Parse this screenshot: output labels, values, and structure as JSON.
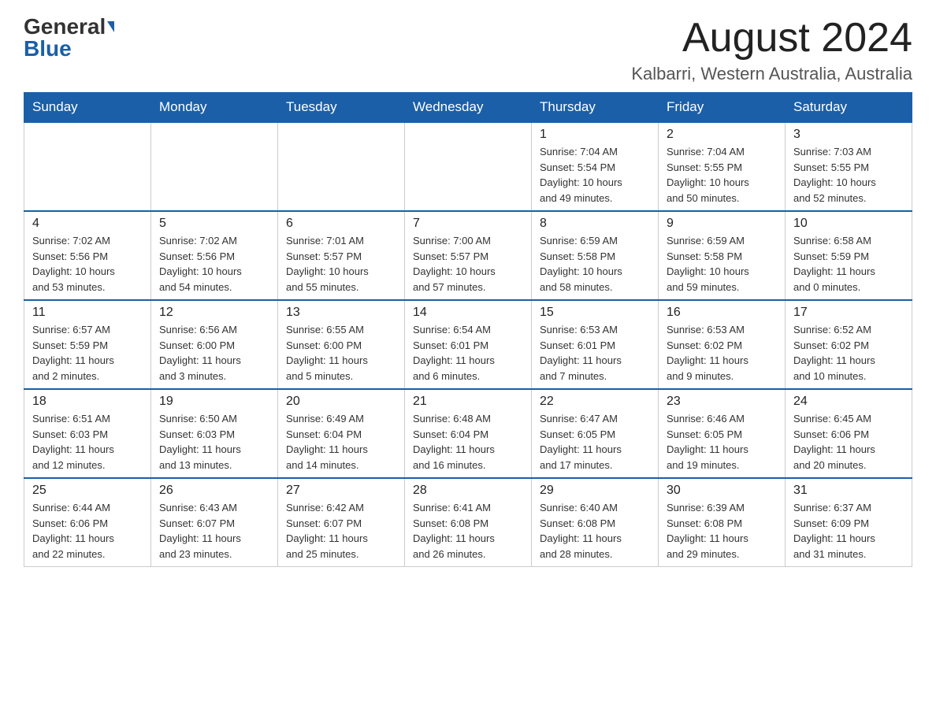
{
  "logo": {
    "general": "General",
    "blue": "Blue"
  },
  "title": "August 2024",
  "location": "Kalbarri, Western Australia, Australia",
  "weekdays": [
    "Sunday",
    "Monday",
    "Tuesday",
    "Wednesday",
    "Thursday",
    "Friday",
    "Saturday"
  ],
  "weeks": [
    [
      {
        "day": "",
        "info": ""
      },
      {
        "day": "",
        "info": ""
      },
      {
        "day": "",
        "info": ""
      },
      {
        "day": "",
        "info": ""
      },
      {
        "day": "1",
        "info": "Sunrise: 7:04 AM\nSunset: 5:54 PM\nDaylight: 10 hours\nand 49 minutes."
      },
      {
        "day": "2",
        "info": "Sunrise: 7:04 AM\nSunset: 5:55 PM\nDaylight: 10 hours\nand 50 minutes."
      },
      {
        "day": "3",
        "info": "Sunrise: 7:03 AM\nSunset: 5:55 PM\nDaylight: 10 hours\nand 52 minutes."
      }
    ],
    [
      {
        "day": "4",
        "info": "Sunrise: 7:02 AM\nSunset: 5:56 PM\nDaylight: 10 hours\nand 53 minutes."
      },
      {
        "day": "5",
        "info": "Sunrise: 7:02 AM\nSunset: 5:56 PM\nDaylight: 10 hours\nand 54 minutes."
      },
      {
        "day": "6",
        "info": "Sunrise: 7:01 AM\nSunset: 5:57 PM\nDaylight: 10 hours\nand 55 minutes."
      },
      {
        "day": "7",
        "info": "Sunrise: 7:00 AM\nSunset: 5:57 PM\nDaylight: 10 hours\nand 57 minutes."
      },
      {
        "day": "8",
        "info": "Sunrise: 6:59 AM\nSunset: 5:58 PM\nDaylight: 10 hours\nand 58 minutes."
      },
      {
        "day": "9",
        "info": "Sunrise: 6:59 AM\nSunset: 5:58 PM\nDaylight: 10 hours\nand 59 minutes."
      },
      {
        "day": "10",
        "info": "Sunrise: 6:58 AM\nSunset: 5:59 PM\nDaylight: 11 hours\nand 0 minutes."
      }
    ],
    [
      {
        "day": "11",
        "info": "Sunrise: 6:57 AM\nSunset: 5:59 PM\nDaylight: 11 hours\nand 2 minutes."
      },
      {
        "day": "12",
        "info": "Sunrise: 6:56 AM\nSunset: 6:00 PM\nDaylight: 11 hours\nand 3 minutes."
      },
      {
        "day": "13",
        "info": "Sunrise: 6:55 AM\nSunset: 6:00 PM\nDaylight: 11 hours\nand 5 minutes."
      },
      {
        "day": "14",
        "info": "Sunrise: 6:54 AM\nSunset: 6:01 PM\nDaylight: 11 hours\nand 6 minutes."
      },
      {
        "day": "15",
        "info": "Sunrise: 6:53 AM\nSunset: 6:01 PM\nDaylight: 11 hours\nand 7 minutes."
      },
      {
        "day": "16",
        "info": "Sunrise: 6:53 AM\nSunset: 6:02 PM\nDaylight: 11 hours\nand 9 minutes."
      },
      {
        "day": "17",
        "info": "Sunrise: 6:52 AM\nSunset: 6:02 PM\nDaylight: 11 hours\nand 10 minutes."
      }
    ],
    [
      {
        "day": "18",
        "info": "Sunrise: 6:51 AM\nSunset: 6:03 PM\nDaylight: 11 hours\nand 12 minutes."
      },
      {
        "day": "19",
        "info": "Sunrise: 6:50 AM\nSunset: 6:03 PM\nDaylight: 11 hours\nand 13 minutes."
      },
      {
        "day": "20",
        "info": "Sunrise: 6:49 AM\nSunset: 6:04 PM\nDaylight: 11 hours\nand 14 minutes."
      },
      {
        "day": "21",
        "info": "Sunrise: 6:48 AM\nSunset: 6:04 PM\nDaylight: 11 hours\nand 16 minutes."
      },
      {
        "day": "22",
        "info": "Sunrise: 6:47 AM\nSunset: 6:05 PM\nDaylight: 11 hours\nand 17 minutes."
      },
      {
        "day": "23",
        "info": "Sunrise: 6:46 AM\nSunset: 6:05 PM\nDaylight: 11 hours\nand 19 minutes."
      },
      {
        "day": "24",
        "info": "Sunrise: 6:45 AM\nSunset: 6:06 PM\nDaylight: 11 hours\nand 20 minutes."
      }
    ],
    [
      {
        "day": "25",
        "info": "Sunrise: 6:44 AM\nSunset: 6:06 PM\nDaylight: 11 hours\nand 22 minutes."
      },
      {
        "day": "26",
        "info": "Sunrise: 6:43 AM\nSunset: 6:07 PM\nDaylight: 11 hours\nand 23 minutes."
      },
      {
        "day": "27",
        "info": "Sunrise: 6:42 AM\nSunset: 6:07 PM\nDaylight: 11 hours\nand 25 minutes."
      },
      {
        "day": "28",
        "info": "Sunrise: 6:41 AM\nSunset: 6:08 PM\nDaylight: 11 hours\nand 26 minutes."
      },
      {
        "day": "29",
        "info": "Sunrise: 6:40 AM\nSunset: 6:08 PM\nDaylight: 11 hours\nand 28 minutes."
      },
      {
        "day": "30",
        "info": "Sunrise: 6:39 AM\nSunset: 6:08 PM\nDaylight: 11 hours\nand 29 minutes."
      },
      {
        "day": "31",
        "info": "Sunrise: 6:37 AM\nSunset: 6:09 PM\nDaylight: 11 hours\nand 31 minutes."
      }
    ]
  ]
}
